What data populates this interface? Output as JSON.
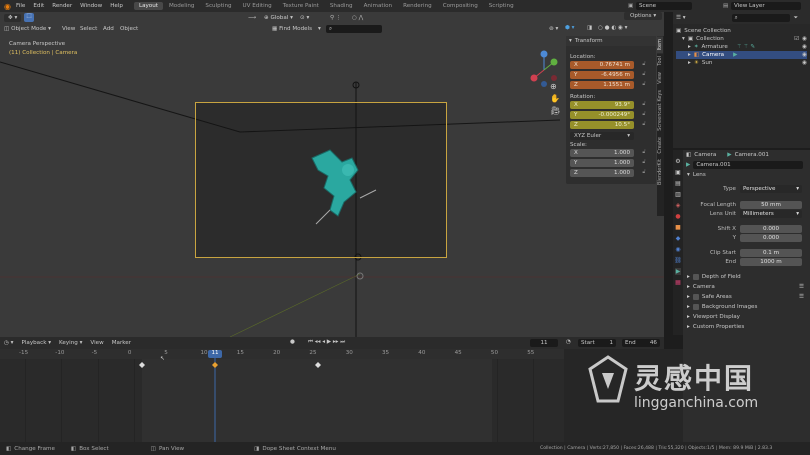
{
  "topbar": {
    "menus": [
      "File",
      "Edit",
      "Render",
      "Window",
      "Help"
    ],
    "workspaces": [
      "Layout",
      "Modeling",
      "Sculpting",
      "UV Editing",
      "Texture Paint",
      "Shading",
      "Animation",
      "Rendering",
      "Compositing",
      "Scripting"
    ],
    "active_workspace": "Layout",
    "scene": "Scene",
    "view_layer": "View Layer"
  },
  "viewport": {
    "mode": "Object Mode",
    "menus": [
      "View",
      "Select",
      "Add",
      "Object"
    ],
    "orientation": "Global",
    "find_models": "Find Models",
    "options": "Options",
    "overlay_title": "Camera Perspective",
    "overlay_subtitle": "(11) Collection | Camera"
  },
  "npanel": {
    "header": "Transform",
    "location_label": "Location:",
    "location": [
      {
        "axis": "X",
        "value": "0.76741 m"
      },
      {
        "axis": "Y",
        "value": "-6.4956 m"
      },
      {
        "axis": "Z",
        "value": "1.1551 m"
      }
    ],
    "rotation_label": "Rotation:",
    "rotation": [
      {
        "axis": "X",
        "value": "93.9°"
      },
      {
        "axis": "Y",
        "value": "-0.000249°"
      },
      {
        "axis": "Z",
        "value": "10.5°"
      }
    ],
    "rotation_mode": "XYZ Euler",
    "scale_label": "Scale:",
    "scale": [
      {
        "axis": "X",
        "value": "1.000"
      },
      {
        "axis": "Y",
        "value": "1.000"
      },
      {
        "axis": "Z",
        "value": "1.000"
      }
    ],
    "side_tabs": [
      "Item",
      "Tool",
      "View",
      "Screencast Keys",
      "Create",
      "BlenderKit"
    ]
  },
  "outliner": {
    "root": "Scene Collection",
    "collection": "Collection",
    "items": [
      {
        "name": "Armature",
        "selected": false
      },
      {
        "name": "Camera",
        "selected": true
      },
      {
        "name": "Sun",
        "selected": false
      }
    ]
  },
  "props": {
    "object_name": "Camera",
    "data_name": "Camera.001",
    "data_field": "Camera.001",
    "lens_panel": "Lens",
    "type_label": "Type",
    "type_value": "Perspective",
    "focal_label": "Focal Length",
    "focal_value": "50 mm",
    "lens_unit_label": "Lens Unit",
    "lens_unit_value": "Millimeters",
    "shift_x_label": "Shift X",
    "shift_x_value": "0.000",
    "shift_y_label": "Y",
    "shift_y_value": "0.000",
    "clip_start_label": "Clip Start",
    "clip_start_value": "0.1 m",
    "clip_end_label": "End",
    "clip_end_value": "1000 m",
    "panels": [
      "Depth of Field",
      "Camera",
      "Safe Areas",
      "Background Images",
      "Viewport Display",
      "Custom Properties"
    ]
  },
  "timeline": {
    "menus": [
      "Playback",
      "Keying",
      "View",
      "Marker"
    ],
    "current_frame": "11",
    "start_label": "Start",
    "start": "1",
    "end_label": "End",
    "end": "46",
    "ticks": [
      "-15",
      "-10",
      "-5",
      "0",
      "5",
      "10",
      "15",
      "20",
      "25",
      "30",
      "35",
      "40",
      "45",
      "50",
      "55"
    ]
  },
  "status": {
    "change_frame": "Change Frame",
    "box_select": "Box Select",
    "pan_view": "Pan View",
    "context_menu": "Dope Sheet Context Menu",
    "stats": "Collection | Camera | Verts:27,850 | Faces:26,488 | Tris:55,320 | Objects:1/5 | Mem: 89.9 MiB | 2.83.3"
  },
  "watermark": {
    "cn": "灵感中国",
    "url": "lingganchina.com"
  },
  "colors": {
    "accent_blue": "#3d68a8",
    "camera_frame": "#c8a440",
    "char_teal": "#2aa8a0"
  }
}
